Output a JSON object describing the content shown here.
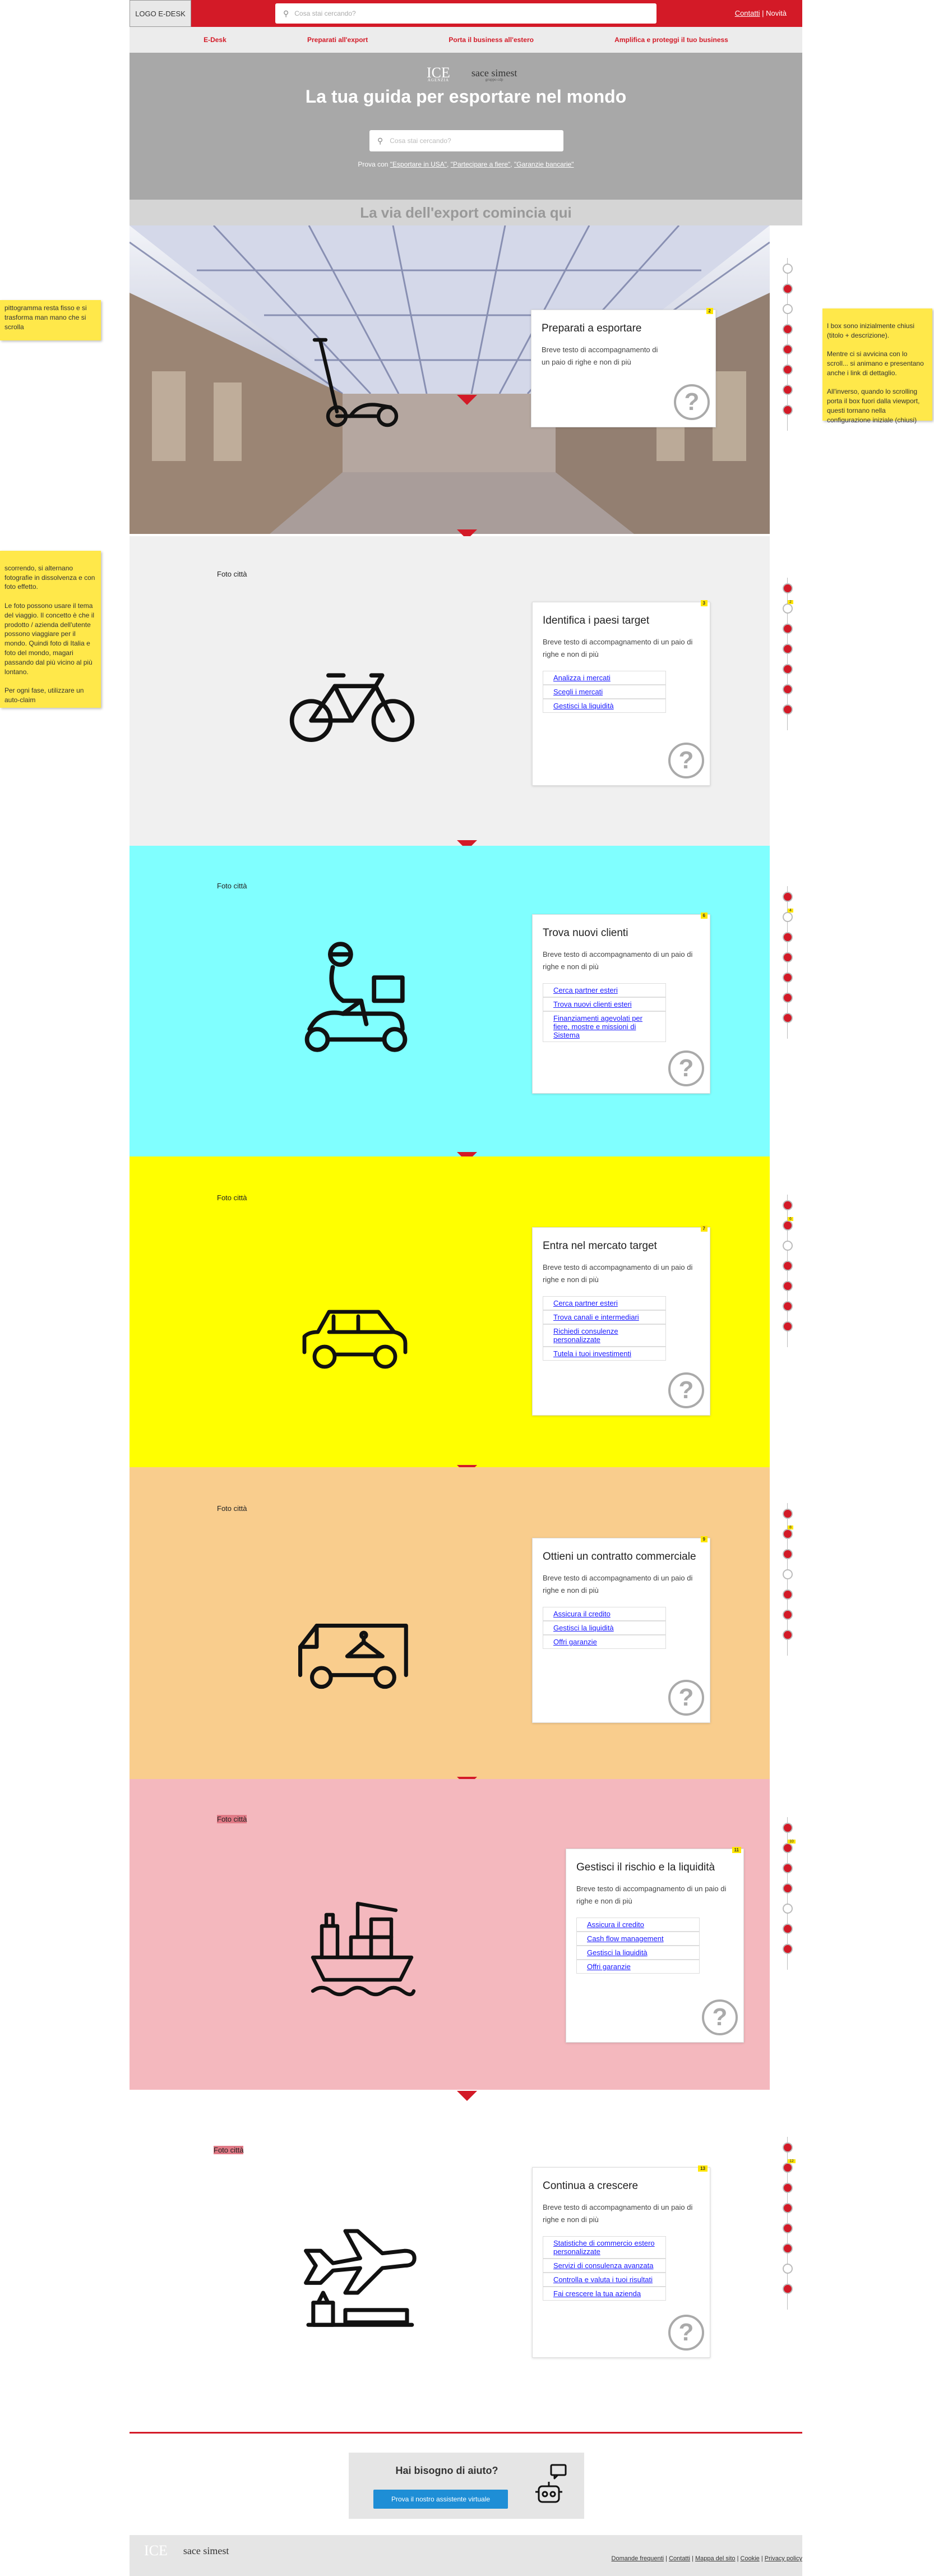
{
  "header": {
    "logo_label": "LOGO E-DESK",
    "search_placeholder": "Cosa stai cercando?",
    "contacts_label": "Contatti",
    "separator": "|",
    "news_label": "Novità"
  },
  "nav": {
    "items": [
      {
        "label": "E-Desk"
      },
      {
        "label": "Preparati all'export"
      },
      {
        "label": "Porta il business all'estero"
      },
      {
        "label": "Amplifica e proteggi il tuo business"
      }
    ]
  },
  "hero": {
    "logo_ice": "ICE",
    "logo_ice_sub": "AGENZIA",
    "logo_sace": "sace simest",
    "logo_sace_sub": "gruppo cdp",
    "title": "La tua guida per esportare nel mondo",
    "search_placeholder": "Cosa stai cercando?",
    "hint_prefix": "Prova con",
    "hint_1": "\"Esportare in USA\"",
    "hint_2": "\"Partecipare a fiere\"",
    "hint_3": "\"Garanzie bancarie\"",
    "hint_sep": ","
  },
  "via": {
    "title": "La via dell'export comincia qui"
  },
  "sections": [
    {
      "photo_label": "",
      "badge": "2",
      "title": "Preparati a esportare",
      "text": "Breve testo di accompagnamento di un paio di righe e non di più",
      "links": [],
      "icon": "scooter-icon"
    },
    {
      "photo_label": "Foto città",
      "badge": "3",
      "title": "Identifica i paesi target",
      "text": "Breve testo di accompagnamento di un paio di righe e non di più",
      "links": [
        "Analizza i mercati",
        "Scegli i mercati",
        "Gestisci la liquidità"
      ],
      "icon": "bicycle-icon"
    },
    {
      "photo_label": "Foto città",
      "badge": "6",
      "title": "Trova nuovi clienti",
      "text": "Breve testo di accompagnamento di un paio di righe e non di più",
      "links": [
        "Cerca partner esteri",
        "Trova nuovi clienti esteri",
        "Finanziamenti agevolati per fiere, mostre e missioni di Sistema"
      ],
      "icon": "delivery-scooter-icon"
    },
    {
      "photo_label": "Foto città",
      "badge": "7",
      "title": "Entra nel mercato target",
      "text": "Breve testo di accompagnamento di un paio di righe e non di più",
      "links": [
        "Cerca partner esteri",
        "Trova canali e intermediari",
        "Richiedi consulenze personalizzate",
        "Tutela i tuoi investimenti"
      ],
      "icon": "car-icon"
    },
    {
      "photo_label": "Foto città",
      "badge": "9",
      "title": "Ottieni un contratto commerciale",
      "text": "Breve testo di accompagnamento di un paio di righe e non di più",
      "links": [
        "Assicura il credito",
        "Gestisci la liquidità",
        "Offri garanzie"
      ],
      "icon": "van-icon"
    },
    {
      "photo_label": "Foto città",
      "badge": "11",
      "title": "Gestisci il rischio e la liquidità",
      "text": "Breve testo di accompagnamento di un paio di righe e non di più",
      "links": [
        "Assicura il credito",
        "Cash flow management",
        "Gestisci la liquidità",
        "Offri garanzie"
      ],
      "icon": "cargo-ship-icon"
    },
    {
      "photo_label": "Foto città",
      "badge": "13",
      "title": "Continua a crescere",
      "text": "Breve testo di accompagnamento di un paio di righe e non di più",
      "links": [
        "Statistiche di commercio estero personalizzate",
        "Servizi di consulenza avanzata",
        "Controlla e valuta i tuoi risultati",
        "Fai crescere la tua azienda"
      ],
      "icon": "airplane-icon"
    }
  ],
  "timeline_badges": [
    "2",
    "4",
    "6",
    "8",
    "10",
    "12"
  ],
  "notes": {
    "left_1": "pittogramma resta fisso e si trasforma man mano che si scrolla",
    "left_2": "scorrendo, si alternano fotografie in dissolvenza e con foto effetto.\n\nLe foto possono usare il tema del viaggio. Il concetto è che il prodotto / azienda dell'utente possono viaggiare per il mondo. Quindi foto di Italia e foto del mondo, magari passando dal più vicino al più lontano.\n\nPer ogni fase, utilizzare un auto-claim",
    "right_1": "I box sono inizialmente chiusi (titolo + descrizione).\n\nMentre ci si avvicina con lo scroll... si animano e presentano anche i link di dettaglio.\n\nAll'inverso, quando lo scrolling porta il box fuori dalla viewport, questi tornano nella configurazione iniziale (chiusi)"
  },
  "help": {
    "title": "Hai bisogno di aiuto?",
    "button": "Prova il nostro assistente virtuale"
  },
  "footer": {
    "logo_ice": "ICE",
    "logo_sace": "sace simest",
    "links": [
      "Domande frequenti",
      "Contatti",
      "Mappa del sito",
      "Cookie",
      "Privacy policy"
    ]
  },
  "colors": {
    "brand_red": "#d31a27",
    "cyan": "#80ffff",
    "yellow": "#ffff00",
    "peach": "#f9cd8d",
    "pink": "#f4b8be",
    "note_yellow": "#ffe84a",
    "button_blue": "#1e8ed6"
  }
}
